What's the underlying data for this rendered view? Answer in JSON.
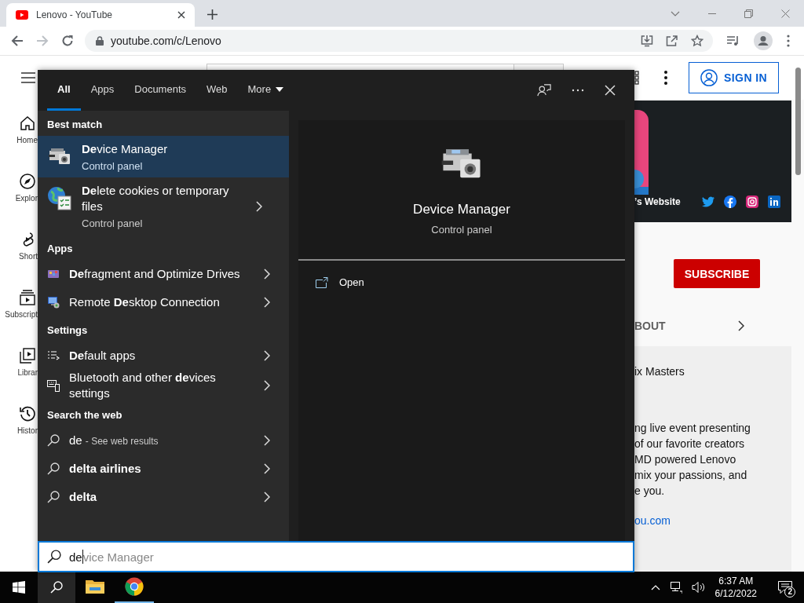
{
  "browser": {
    "tab": {
      "title": "Lenovo - YouTube"
    },
    "forward_disabled": true,
    "address": "youtube.com/c/Lenovo"
  },
  "youtube": {
    "sidebar": [
      "Home",
      "Explor",
      "Short",
      "Subscript",
      "Librar",
      "Histor"
    ],
    "sign_in": "SIGN IN",
    "banner_link": "’s Website",
    "subscribe": "SUBSCRIBE",
    "tab": "BOUT",
    "about": {
      "title": "ix Masters",
      "description": "ng live event presenting\n of our favorite creators\nMD powered Lenovo\nmix your passions, and\ne you.",
      "link": "ou.com"
    }
  },
  "search_panel": {
    "tabs": [
      {
        "label": "All",
        "selected": true
      },
      {
        "label": "Apps",
        "selected": false
      },
      {
        "label": "Documents",
        "selected": false
      },
      {
        "label": "Web",
        "selected": false
      },
      {
        "label": "More",
        "selected": false
      }
    ],
    "groups": [
      {
        "heading": "Best match",
        "items": [
          {
            "kind": "tile",
            "title": "**De**vice Manager",
            "subtitle": "Control panel",
            "selected": true
          },
          {
            "kind": "tile",
            "title": "**De**lete cookies or temporary files",
            "subtitle": "Control panel",
            "selected": false
          }
        ]
      },
      {
        "heading": "Apps",
        "items": [
          {
            "kind": "row",
            "title": "**De**fragment and Optimize Drives",
            "selected": false
          },
          {
            "kind": "row",
            "title": "Remote **De**sktop Connection",
            "selected": false
          }
        ]
      },
      {
        "heading": "Settings",
        "items": [
          {
            "kind": "row",
            "title": "**De**fault apps",
            "selected": false
          },
          {
            "kind": "row",
            "title": "Bluetooth and other **de**vices settings",
            "selected": false
          }
        ]
      },
      {
        "heading": "Search the web",
        "items": [
          {
            "kind": "web",
            "title": "de",
            "hint": "- See web results",
            "selected": false
          },
          {
            "kind": "suggestion",
            "title": "delta airlines",
            "selected": false
          },
          {
            "kind": "suggestion",
            "title": "delta",
            "selected": false
          }
        ]
      }
    ],
    "preview": {
      "title": "Device Manager",
      "subtitle": "Control panel",
      "actions": [
        "Open"
      ]
    },
    "query": {
      "value": "de",
      "suggestion": "vice Manager"
    }
  },
  "taskbar": {
    "search_active": true,
    "apps": [
      {
        "kind": "explorer",
        "running": false
      },
      {
        "kind": "chrome",
        "running": true
      }
    ],
    "clock": {
      "time": "6:37 AM",
      "date": "6/12/2022"
    },
    "notifications": "2"
  }
}
